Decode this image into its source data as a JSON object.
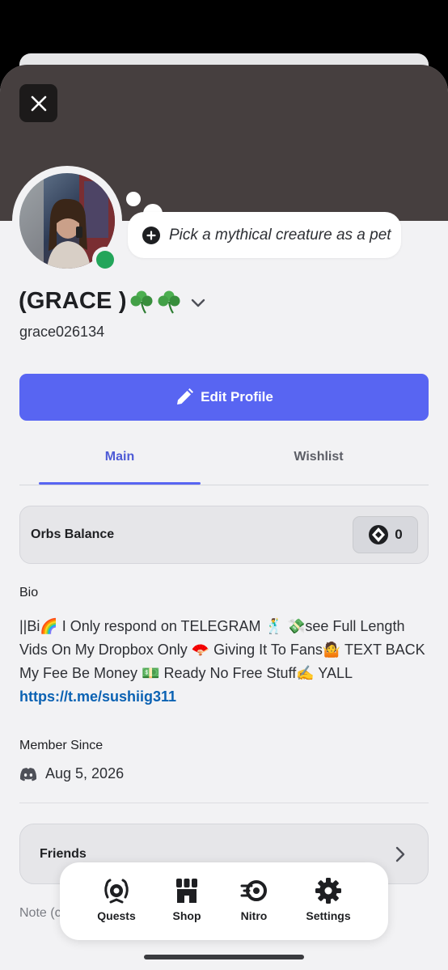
{
  "profile": {
    "status_text": "Pick a mythical creature as a pet",
    "display_name": "(GRACE )",
    "display_name_emoji": "☘️☘️",
    "username": "grace026134",
    "status": "online"
  },
  "edit_button": {
    "label": "Edit Profile"
  },
  "tabs": [
    {
      "label": "Main",
      "active": true
    },
    {
      "label": "Wishlist",
      "active": false
    }
  ],
  "orbs": {
    "label": "Orbs Balance",
    "value": "0"
  },
  "bio": {
    "heading": "Bio",
    "text": "||Bi🌈 I Only respond on TELEGRAM 🕺 💸see Full Length Vids On My Dropbox Only 🪭 Giving It To Fans🤷 TEXT BACK My Fee Be Money 💵 Ready No Free Stuff✍️ YALL ",
    "link": "https://t.me/sushiig311"
  },
  "member_since": {
    "heading": "Member Since",
    "date": "Aug 5, 2026"
  },
  "friends": {
    "label": "Friends"
  },
  "note": {
    "label": "Note (c"
  },
  "tabbar": {
    "items": [
      {
        "label": "Quests",
        "icon": "quests-icon"
      },
      {
        "label": "Shop",
        "icon": "shop-icon"
      },
      {
        "label": "Nitro",
        "icon": "nitro-icon"
      },
      {
        "label": "Settings",
        "icon": "gear-icon"
      }
    ]
  },
  "colors": {
    "accent": "#5865f2",
    "banner": "#463f3f",
    "online": "#23a55a",
    "link": "#0b62b3"
  }
}
